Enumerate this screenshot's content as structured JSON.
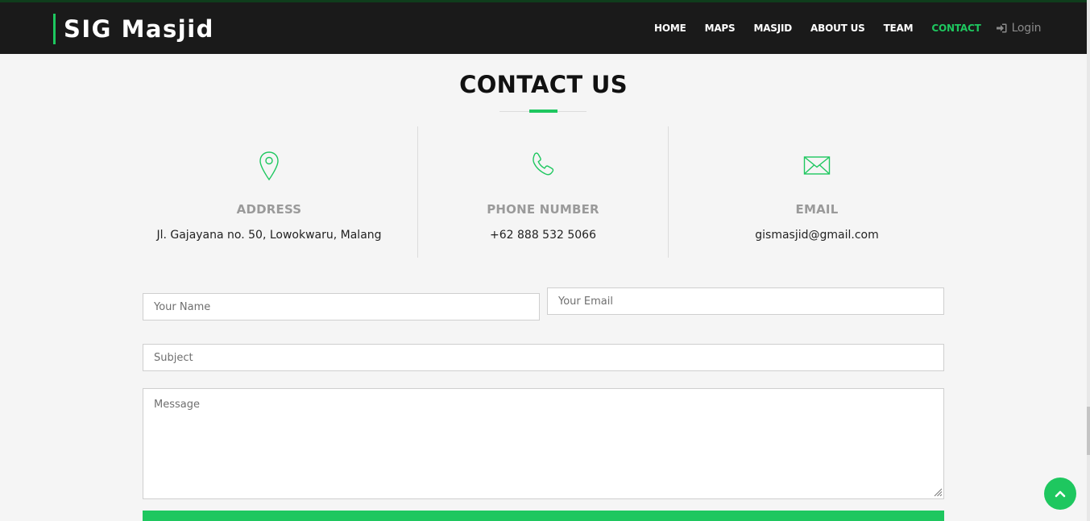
{
  "brand": {
    "name": "SIG Masjid"
  },
  "nav": {
    "items": [
      {
        "label": "HOME",
        "active": false
      },
      {
        "label": "MAPS",
        "active": false
      },
      {
        "label": "MASJID",
        "active": false
      },
      {
        "label": "ABOUT US",
        "active": false
      },
      {
        "label": "TEAM",
        "active": false
      },
      {
        "label": "CONTACT",
        "active": true
      }
    ],
    "login": {
      "label": "Login",
      "icon": "sign-in-icon"
    }
  },
  "section": {
    "title": "CONTACT US"
  },
  "info": [
    {
      "icon": "map-pin-icon",
      "label": "ADDRESS",
      "value": "Jl. Gajayana no. 50, Lowokwaru, Malang"
    },
    {
      "icon": "phone-icon",
      "label": "PHONE NUMBER",
      "value": "+62 888 532 5066"
    },
    {
      "icon": "envelope-icon",
      "label": "EMAIL",
      "value": "gismasjid@gmail.com"
    }
  ],
  "form": {
    "name_placeholder": "Your Name",
    "email_placeholder": "Your Email",
    "subject_placeholder": "Subject",
    "message_placeholder": "Message"
  },
  "colors": {
    "accent": "#1ec75f",
    "navbar": "#1a1a1a",
    "background": "#f5f5f5"
  },
  "back_to_top": {
    "icon": "chevron-up-icon"
  }
}
